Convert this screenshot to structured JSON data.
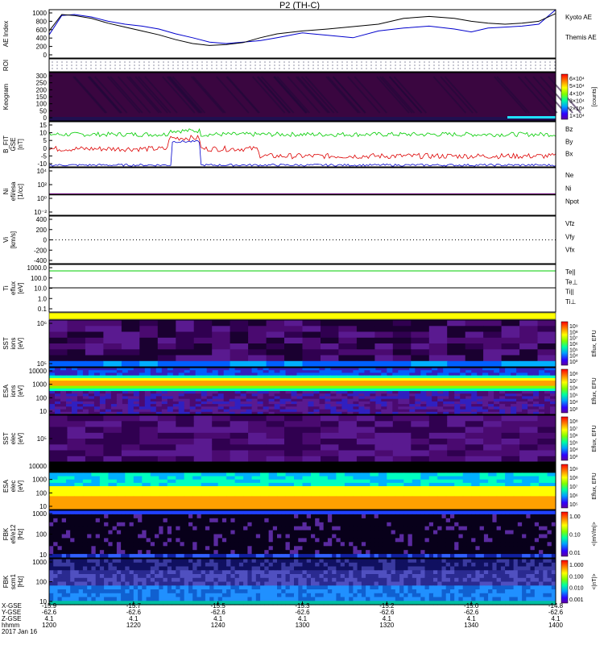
{
  "title": "P2 (TH-C)",
  "colors": {
    "blue": "#0000cc",
    "green": "#00cc00",
    "red": "#dd0000",
    "black": "#000000"
  },
  "chart_data": [
    {
      "id": "ae",
      "type": "line",
      "ylabel": "AE Index",
      "ylim": [
        0,
        1000
      ],
      "yticks": [
        "1000",
        "800",
        "600",
        "400",
        "200",
        "0"
      ],
      "series": [
        {
          "name": "Kyoto AE",
          "color": "#0000cc",
          "x": [
            0,
            3,
            6,
            10,
            14,
            18,
            22,
            26,
            30,
            34,
            38,
            42,
            46,
            50,
            54,
            60,
            66,
            72,
            78,
            84,
            90,
            96,
            100,
            104,
            108,
            112,
            116,
            120
          ],
          "values": [
            480,
            880,
            900,
            850,
            760,
            700,
            660,
            600,
            500,
            420,
            330,
            300,
            330,
            360,
            420,
            520,
            470,
            420,
            560,
            620,
            660,
            600,
            540,
            620,
            640,
            660,
            700,
            1000
          ]
        },
        {
          "name": "Themis AE",
          "color": "#000000",
          "x": [
            0,
            3,
            6,
            10,
            14,
            18,
            22,
            26,
            30,
            34,
            38,
            42,
            46,
            50,
            54,
            60,
            66,
            72,
            78,
            84,
            90,
            96,
            100,
            104,
            108,
            112,
            116,
            120
          ],
          "values": [
            560,
            900,
            880,
            820,
            720,
            640,
            560,
            480,
            380,
            300,
            260,
            280,
            320,
            420,
            500,
            560,
            600,
            650,
            700,
            820,
            860,
            820,
            760,
            720,
            700,
            720,
            760,
            920
          ]
        }
      ]
    },
    {
      "id": "roi",
      "type": "table",
      "ylabel": "ROI"
    },
    {
      "id": "keogram",
      "type": "heatmap",
      "ylabel": "Keogram",
      "ylim": [
        0,
        300
      ],
      "yticks": [
        "300",
        "250",
        "200",
        "150",
        "100",
        "50",
        "0"
      ],
      "colorbar": {
        "label": "[counts]",
        "ticks": [
          "6×10⁴",
          "5×10⁴",
          "4×10⁴",
          "3×10⁴",
          "2×10⁴",
          "1×10⁴"
        ]
      }
    },
    {
      "id": "bfit",
      "type": "line",
      "ylabel": "B_FIT",
      "ylabel2": "GSE",
      "units": "[nT]",
      "ylim": [
        -10,
        15
      ],
      "yticks": [
        "15",
        "10",
        "5",
        "0",
        "-5",
        "-10"
      ],
      "series": [
        {
          "name": "Bz",
          "color": "#dd0000"
        },
        {
          "name": "By",
          "color": "#00cc00"
        },
        {
          "name": "Bx",
          "color": "#0000cc"
        }
      ]
    },
    {
      "id": "ni",
      "type": "line",
      "ylabel": "Ni",
      "ylabel2": "efi/esa",
      "units": "[1/cc]",
      "yticks": [
        "10⁴",
        "10²",
        "10⁰",
        "10⁻²"
      ],
      "series": [
        {
          "name": "Ne",
          "color": "#dd0000"
        },
        {
          "name": "Ni",
          "color": "#000000"
        },
        {
          "name": "Npot",
          "color": "#0000cc"
        }
      ]
    },
    {
      "id": "vi",
      "type": "line",
      "ylabel": "Vi",
      "units": "[km/s]",
      "ylim": [
        -500,
        500
      ],
      "yticks": [
        "400",
        "200",
        "0",
        "-200",
        "-400"
      ],
      "series": [
        {
          "name": "Vfz",
          "color": "#dd0000"
        },
        {
          "name": "Vfy",
          "color": "#00cc00"
        },
        {
          "name": "Vfx",
          "color": "#0000cc"
        }
      ]
    },
    {
      "id": "ti",
      "type": "line",
      "ylabel": "Ti",
      "ylabel2": "eflux",
      "units": "[eV]",
      "yticks": [
        "1000.0",
        "100.0",
        "10.0",
        "1.0",
        "0.1"
      ],
      "series": [
        {
          "name": "Te||",
          "color": "#000000"
        },
        {
          "name": "Te⊥",
          "color": "#dd0000"
        },
        {
          "name": "Ti||",
          "color": "#00cc00"
        },
        {
          "name": "Ti⊥",
          "color": "#0000cc"
        }
      ]
    },
    {
      "id": "sst_i",
      "type": "heatmap",
      "ylabel": "SST",
      "ylabel2": "ions",
      "units": "[eV]",
      "yticks": [
        "10⁶",
        "10⁵"
      ],
      "colorbar": {
        "label": "Eflux, EFU",
        "ticks": [
          "10⁹",
          "10⁸",
          "10⁷",
          "10⁶",
          "10⁵",
          "10⁴",
          "10³"
        ]
      }
    },
    {
      "id": "esa_i",
      "type": "heatmap",
      "ylabel": "ESA",
      "ylabel2": "ions",
      "units": "[eV]",
      "yticks": [
        "10000",
        "1000",
        "100",
        "10"
      ],
      "colorbar": {
        "label": "Eflux, EFU",
        "ticks": [
          "10⁸",
          "10⁷",
          "10⁶",
          "10⁵",
          "10⁴",
          "10³"
        ]
      }
    },
    {
      "id": "sst_e",
      "type": "heatmap",
      "ylabel": "SST",
      "ylabel2": "elec",
      "units": "[eV]",
      "yticks": [
        "10⁵"
      ],
      "colorbar": {
        "label": "Eflux, EFU",
        "ticks": [
          "10⁸",
          "10⁷",
          "10⁶",
          "10⁵",
          "10⁴",
          "10³"
        ]
      }
    },
    {
      "id": "esa_e",
      "type": "heatmap",
      "ylabel": "ESA",
      "ylabel2": "elec",
      "units": "[eV]",
      "yticks": [
        "10000",
        "1000",
        "100",
        "10"
      ],
      "colorbar": {
        "label": "Eflux, EFU",
        "ticks": [
          "10⁹",
          "10⁸",
          "10⁷",
          "10⁶",
          "10⁵"
        ]
      }
    },
    {
      "id": "fbk_e",
      "type": "heatmap",
      "ylabel": "FBK",
      "ylabel2": "efi/e12",
      "units": "[Hz]",
      "yticks": [
        "1000",
        "100",
        "10"
      ],
      "colorbar": {
        "label": "<|mV/m|>",
        "ticks": [
          "1.00",
          "0.10",
          "0.01"
        ]
      }
    },
    {
      "id": "fbk_b",
      "type": "heatmap",
      "ylabel": "FBK",
      "ylabel2": "scm1",
      "units": "[Hz]",
      "yticks": [
        "1000",
        "100",
        "10"
      ],
      "colorbar": {
        "label": "<|nT|>",
        "ticks": [
          "1.000",
          "0.100",
          "0.010",
          "0.001"
        ]
      }
    }
  ],
  "x_axis": {
    "row_labels": [
      "X-GSE",
      "Y-GSE",
      "Z-GSE",
      "hhmm",
      "2017 Jan 16"
    ],
    "ticks": [
      {
        "x": "-15.9",
        "y": "-62.6",
        "z": "4.1",
        "t": "1200"
      },
      {
        "x": "-15.7",
        "y": "-62.6",
        "z": "4.1",
        "t": "1220"
      },
      {
        "x": "-15.5",
        "y": "-62.6",
        "z": "4.1",
        "t": "1240"
      },
      {
        "x": "-15.3",
        "y": "-62.6",
        "z": "4.1",
        "t": "1300"
      },
      {
        "x": "-15.2",
        "y": "-62.6",
        "z": "4.1",
        "t": "1320"
      },
      {
        "x": "-15.0",
        "y": "-62.6",
        "z": "4.1",
        "t": "1340"
      },
      {
        "x": "-14.8",
        "y": "-62.6",
        "z": "4.1",
        "t": "1400"
      }
    ]
  }
}
